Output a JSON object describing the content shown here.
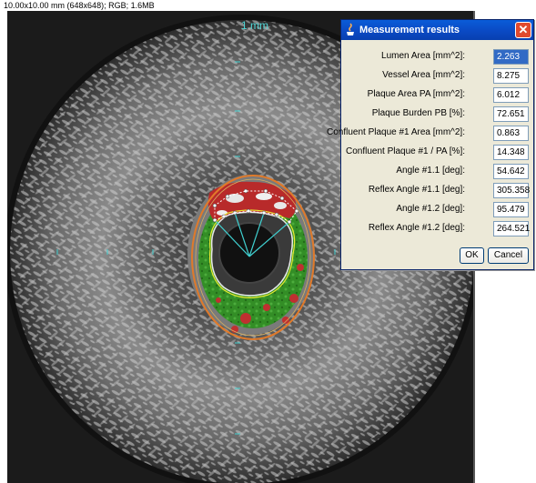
{
  "image_info": "10.00x10.00 mm (648x648); RGB; 1.6MB",
  "scale_label": "1 mm",
  "dialog": {
    "title": "Measurement results",
    "close_label": "✕",
    "rows": [
      {
        "label": "Lumen Area [mm^2]:",
        "value": "2.263"
      },
      {
        "label": "Vessel Area [mm^2]:",
        "value": "8.275"
      },
      {
        "label": "Plaque Area PA [mm^2]:",
        "value": "6.012"
      },
      {
        "label": "Plaque Burden PB [%]:",
        "value": "72.651"
      },
      {
        "label": "Confluent Plaque #1 Area [mm^2]:",
        "value": "0.863"
      },
      {
        "label": "Confluent Plaque #1 / PA [%]:",
        "value": "14.348"
      },
      {
        "label": "Angle #1.1 [deg]:",
        "value": "54.642"
      },
      {
        "label": "Reflex Angle #1.1 [deg]:",
        "value": "305.358"
      },
      {
        "label": "Angle #1.2 [deg]:",
        "value": "95.479"
      },
      {
        "label": "Reflex Angle #1.2 [deg]:",
        "value": "264.521"
      }
    ],
    "ok_label": "OK",
    "cancel_label": "Cancel"
  },
  "colors": {
    "vessel_contour": "#e07a2a",
    "lumen_contour": "#e8e830",
    "plaque_green": "#2e8b1e",
    "plaque_red": "#c03030",
    "angle_lines": "#40d0d0",
    "titlebar": "#0a54d0"
  }
}
